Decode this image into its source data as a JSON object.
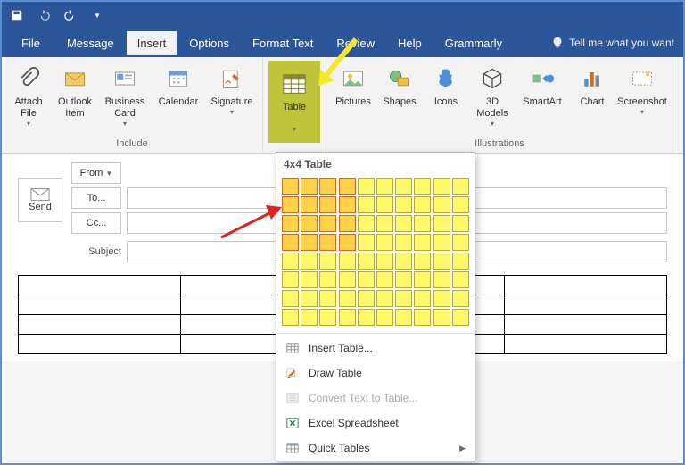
{
  "qat": {
    "save": "save-icon",
    "undo": "undo-icon",
    "redo": "redo-icon"
  },
  "tabs": {
    "file": "File",
    "message": "Message",
    "insert": "Insert",
    "options": "Options",
    "format": "Format Text",
    "review": "Review",
    "help": "Help",
    "grammarly": "Grammarly"
  },
  "tellme": "Tell me what you want",
  "ribbon": {
    "include": {
      "label": "Include",
      "attach": "Attach File",
      "outlook": "Outlook Item",
      "business": "Business Card",
      "calendar": "Calendar",
      "signature": "Signature"
    },
    "table": {
      "label": "Table"
    },
    "illustrations": {
      "label": "Illustrations",
      "pictures": "Pictures",
      "shapes": "Shapes",
      "icons": "Icons",
      "models": "3D Models",
      "smartart": "SmartArt",
      "chart": "Chart",
      "screenshot": "Screenshot"
    }
  },
  "compose": {
    "send": "Send",
    "from": "From",
    "to": "To...",
    "cc": "Cc...",
    "subject": "Subject"
  },
  "popup": {
    "title": "4x4 Table",
    "sel_rows": 4,
    "sel_cols": 4,
    "insert": "Insert Table...",
    "draw": "Draw Table",
    "convert": "Convert Text to Table...",
    "excel": "Excel Spreadsheet",
    "quick": "Quick Tables"
  }
}
